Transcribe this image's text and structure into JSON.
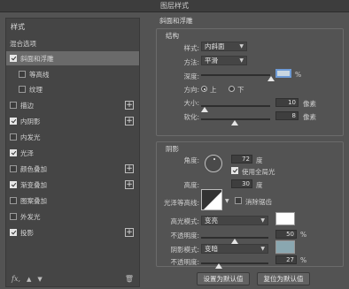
{
  "window": {
    "title": "图层样式"
  },
  "left_panel": {
    "styles_header": "样式",
    "blend_options": "混合选项",
    "items": [
      {
        "label": "斜面和浮雕",
        "checked": true
      },
      {
        "label": "等高线",
        "checked": false
      },
      {
        "label": "纹理",
        "checked": false
      },
      {
        "label": "描边",
        "checked": false
      },
      {
        "label": "内阴影",
        "checked": true
      },
      {
        "label": "内发光",
        "checked": false
      },
      {
        "label": "光泽",
        "checked": true
      },
      {
        "label": "颜色叠加",
        "checked": false
      },
      {
        "label": "渐变叠加",
        "checked": true
      },
      {
        "label": "图案叠加",
        "checked": false
      },
      {
        "label": "外发光",
        "checked": false
      },
      {
        "label": "投影",
        "checked": true
      }
    ],
    "plus": "+",
    "fx": "fx,",
    "up_arrow": "▲",
    "down_arrow": "▼",
    "trash_icon": "🗑"
  },
  "bevel": {
    "section_title": "斜面和浮雕",
    "structure_title": "结构",
    "style_label": "样式:",
    "style_value": "内斜面",
    "technique_label": "方法:",
    "technique_value": "平滑",
    "depth_label": "深度:",
    "depth_value": "",
    "depth_unit": "%",
    "direction_label": "方向:",
    "direction_up": "上",
    "direction_down": "下",
    "size_label": "大小:",
    "size_value": "10",
    "size_unit": "像素",
    "soften_label": "软化:",
    "soften_value": "8",
    "soften_unit": "像素"
  },
  "shading": {
    "title": "阴影",
    "angle_label": "角度:",
    "angle_value": "72",
    "angle_unit": "度",
    "global_light_label": "使用全局光",
    "altitude_label": "高度:",
    "altitude_value": "30",
    "altitude_unit": "度",
    "gloss_contour_label": "光泽等高线:",
    "anti_alias_label": "消除锯齿",
    "highlight_mode_label": "高光模式:",
    "highlight_mode_value": "变亮",
    "highlight_color": "#ffffff",
    "highlight_opacity_label": "不透明度:",
    "highlight_opacity_value": "50",
    "highlight_opacity_unit": "%",
    "shadow_mode_label": "阴影模式:",
    "shadow_mode_value": "变暗",
    "shadow_color": "#8aa7b0",
    "shadow_opacity_label": "不透明度:",
    "shadow_opacity_value": "27",
    "shadow_opacity_unit": "%"
  },
  "buttons": {
    "set_default": "设置为默认值",
    "reset_default": "复位为默认值"
  }
}
